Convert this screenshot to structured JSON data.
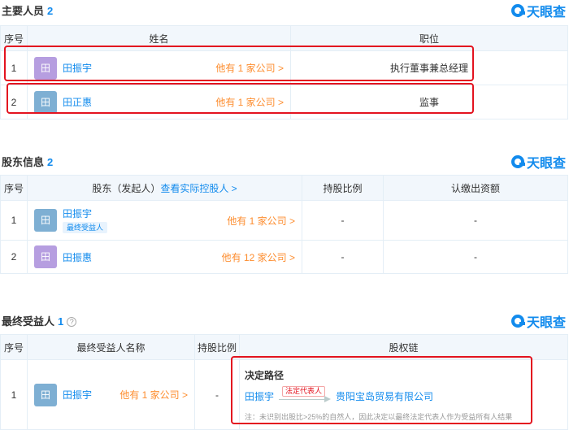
{
  "brand": {
    "name": "天眼查"
  },
  "main_personnel": {
    "title": "主要人员",
    "count": "2",
    "headers": {
      "seq": "序号",
      "name": "姓名",
      "position": "职位"
    },
    "rows": [
      {
        "seq": "1",
        "avatar": "田",
        "avatar_color": "#b69ee0",
        "name": "田振宇",
        "other": "他有 1 家公司 >",
        "position": "执行董事兼总经理"
      },
      {
        "seq": "2",
        "avatar": "田",
        "avatar_color": "#7eafd3",
        "name": "田正惠",
        "other": "他有 1 家公司 >",
        "position": "监事"
      }
    ]
  },
  "shareholders": {
    "title": "股东信息",
    "count": "2",
    "headers": {
      "seq": "序号",
      "holder": "股东（发起人）",
      "holder_link": "查看实际控股人 >",
      "ratio": "持股比例",
      "capital": "认缴出资额"
    },
    "rows": [
      {
        "seq": "1",
        "avatar": "田",
        "avatar_color": "#7eafd3",
        "name": "田振宇",
        "tag": "最终受益人",
        "other": "他有 1 家公司 >",
        "ratio": "-",
        "capital": "-"
      },
      {
        "seq": "2",
        "avatar": "田",
        "avatar_color": "#b69ee0",
        "name": "田振惠",
        "other": "他有 12 家公司 >",
        "ratio": "-",
        "capital": "-"
      }
    ]
  },
  "beneficiaries": {
    "title": "最终受益人",
    "count": "1",
    "help": "?",
    "headers": {
      "seq": "序号",
      "name": "最终受益人名称",
      "ratio": "持股比例",
      "chain": "股权链"
    },
    "rows": [
      {
        "seq": "1",
        "avatar": "田",
        "avatar_color": "#7eafd3",
        "name": "田振宇",
        "other": "他有 1 家公司 >",
        "ratio": "-",
        "chain_title": "决定路径",
        "chain_from": "田振宇",
        "chain_label": "法定代表人",
        "chain_to": "贵阳宝岛贸易有限公司",
        "chain_note": "注：未识别出股比>25%的自然人，因此决定以最终法定代表人作为受益所有人结果"
      }
    ]
  }
}
